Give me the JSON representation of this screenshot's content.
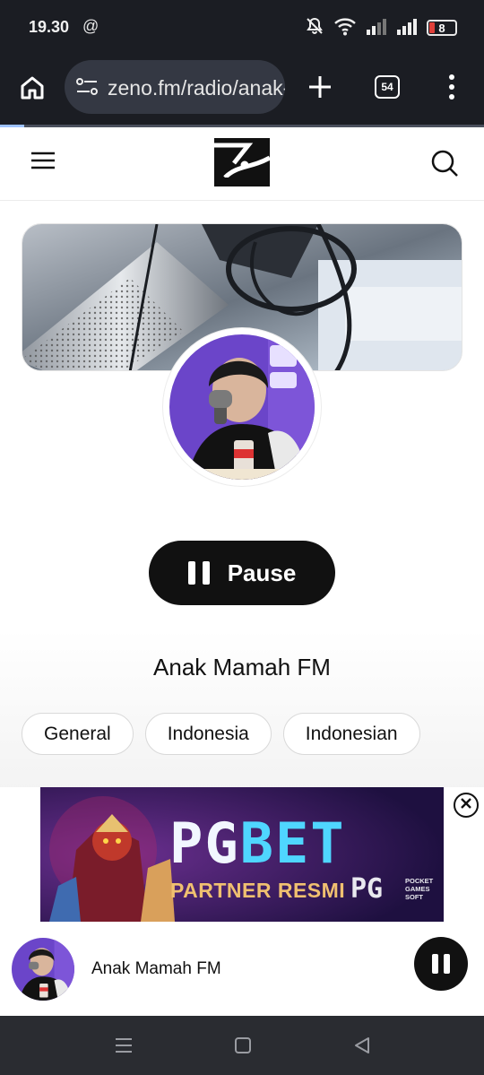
{
  "status_bar": {
    "time": "19.30",
    "at_symbol": "@",
    "battery_level": "8",
    "icons": [
      "bell-muted-icon",
      "wifi-icon",
      "signal-icon",
      "signal-icon",
      "battery-icon"
    ]
  },
  "browser": {
    "url": "zeno.fm/radio/anak-mamah-fm",
    "tab_count": "54",
    "load_progress_fraction": 0.05,
    "icons": [
      "home-icon",
      "site-settings-icon",
      "new-tab-icon",
      "tabs-icon",
      "more-icon"
    ]
  },
  "site": {
    "icons": [
      "menu-icon",
      "zeno-logo-icon",
      "search-icon"
    ]
  },
  "player": {
    "pause_label": "Pause",
    "station_name": "Anak Mamah FM",
    "tags": [
      "General",
      "Indonesia",
      "Indonesian"
    ]
  },
  "ad": {
    "brand": "PGBET",
    "tagline": "PARTNER RESMI",
    "partner_logo": "PG",
    "partner_lines": [
      "POCKET",
      "GAMES",
      "SOFT"
    ]
  },
  "mini_player": {
    "station_name": "Anak Mamah FM"
  },
  "system_nav": {
    "icons": [
      "recents-icon",
      "home-square-icon",
      "back-icon"
    ]
  },
  "colors": {
    "dark_chrome": "#1b1d23",
    "url_pill": "#343843",
    "button_black": "#111111",
    "ad_background": "#2a1750",
    "avatar_purple": "#6b45c9"
  }
}
